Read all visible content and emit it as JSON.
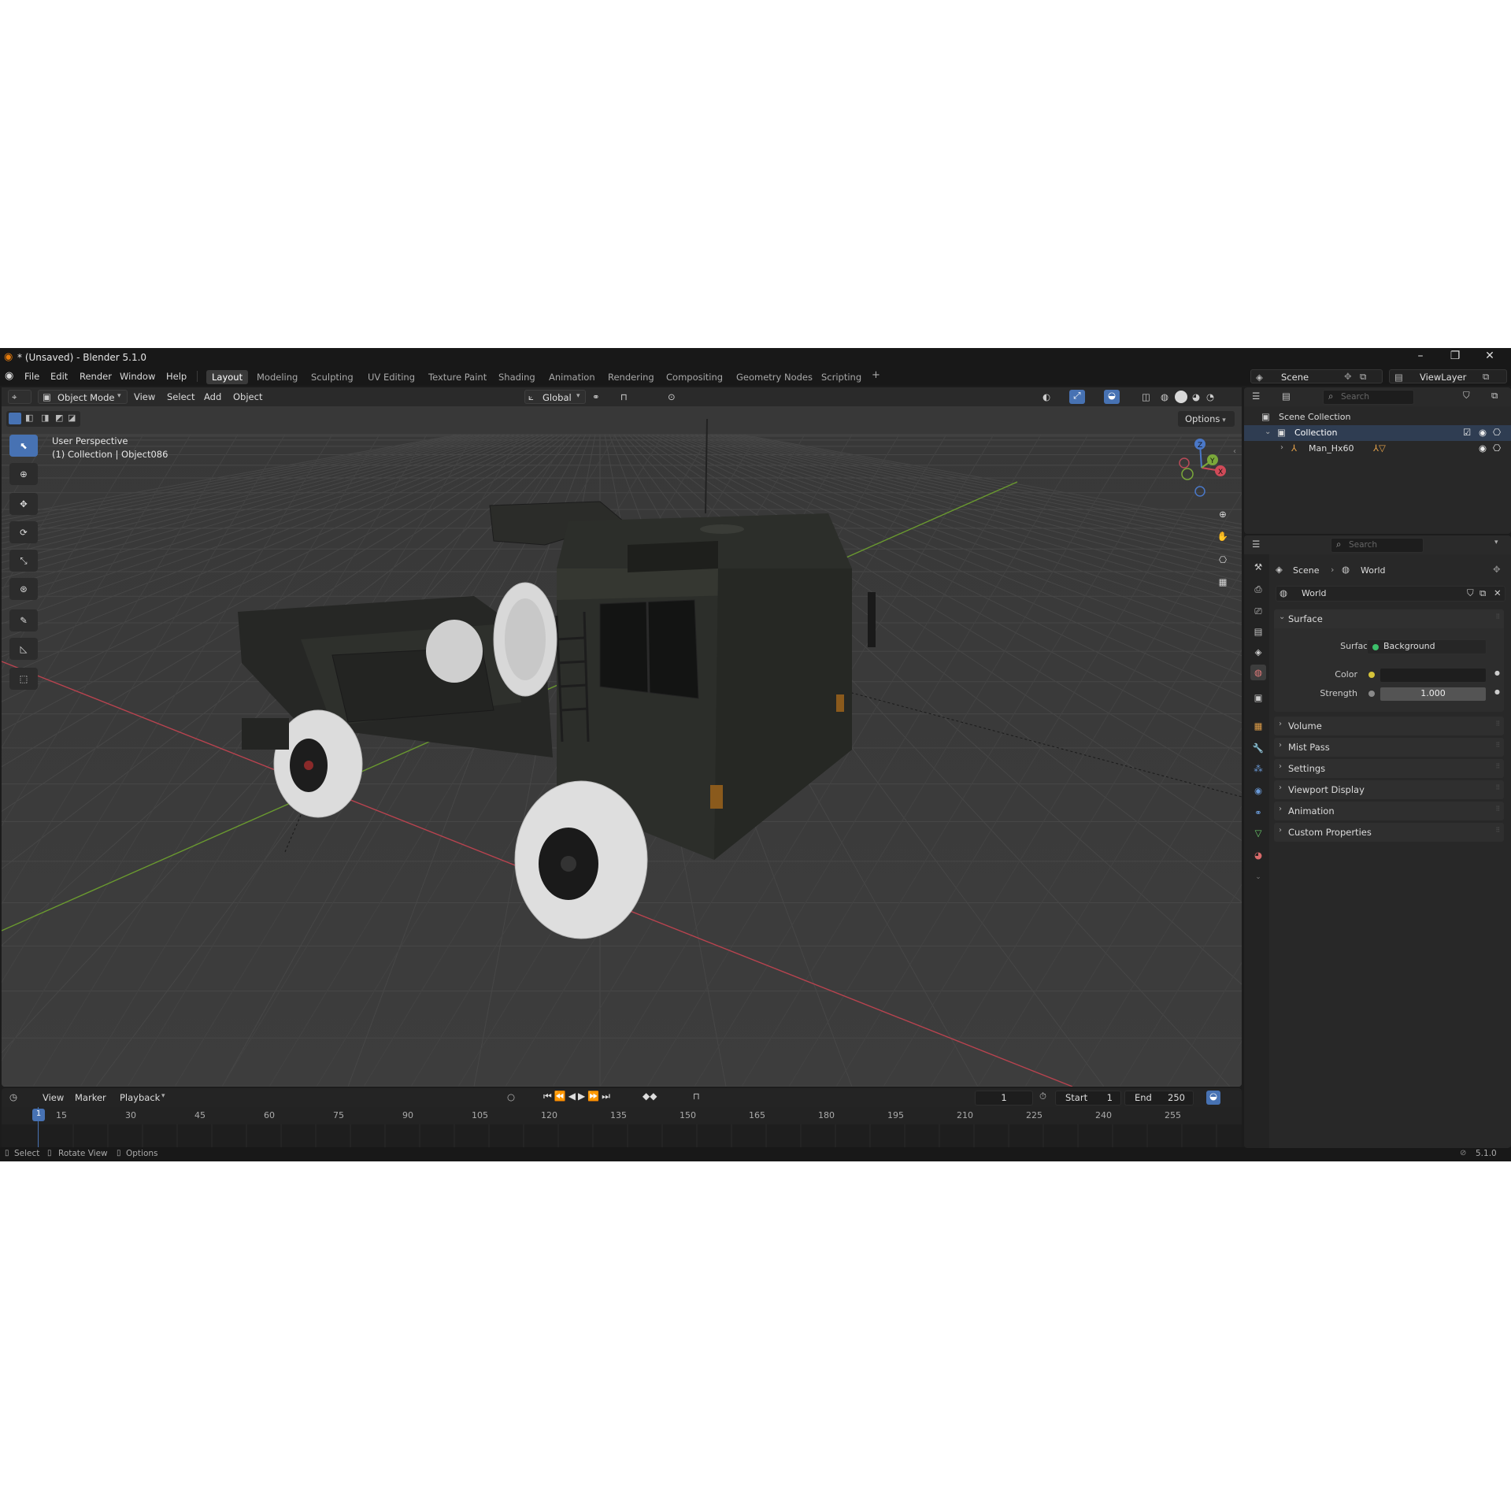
{
  "window": {
    "title": "* (Unsaved) - Blender 5.1.0",
    "minimize": "–",
    "maximize": "❐",
    "close": "✕"
  },
  "menu": {
    "items": [
      "File",
      "Edit",
      "Render",
      "Window",
      "Help"
    ],
    "workspaces": [
      "Layout",
      "Modeling",
      "Sculpting",
      "UV Editing",
      "Texture Paint",
      "Shading",
      "Animation",
      "Rendering",
      "Compositing",
      "Geometry Nodes",
      "Scripting"
    ],
    "active_workspace": "Layout",
    "add_workspace": "+",
    "scene": "Scene",
    "view_layer": "ViewLayer"
  },
  "viewport": {
    "mode": "Object Mode",
    "menus": [
      "View",
      "Select",
      "Add",
      "Object"
    ],
    "transform_orientation": "Global",
    "options": "Options",
    "perspective": "User Perspective",
    "context": "(1) Collection | Object086",
    "gizmo_axes": {
      "x": "X",
      "y": "Y",
      "z": "Z"
    },
    "colors": {
      "background": "#3b3b3b",
      "grid": "#4a4a4a",
      "x_axis": "#b8434f",
      "y_axis": "#6a9a2f",
      "truck": "#2a2c28",
      "tire": "#d8d8d8"
    }
  },
  "outliner": {
    "search_placeholder": "Search",
    "root": "Scene Collection",
    "collection": "Collection",
    "object": "Man_Hx60"
  },
  "properties": {
    "search_placeholder": "Search",
    "breadcrumb": [
      "Scene",
      "World"
    ],
    "world_name": "World",
    "surface_panel": "Surface",
    "surface_label": "Surface",
    "surface_value": "Background",
    "color_label": "Color",
    "strength_label": "Strength",
    "strength_value": "1.000",
    "panels": [
      "Volume",
      "Mist Pass",
      "Settings",
      "Viewport Display",
      "Animation",
      "Custom Properties"
    ]
  },
  "timeline": {
    "menus": [
      "View",
      "Marker",
      "Playback"
    ],
    "current_frame": "1",
    "start_label": "Start",
    "start": "1",
    "end_label": "End",
    "end": "250",
    "ruler": [
      "1",
      "15",
      "30",
      "45",
      "60",
      "75",
      "90",
      "105",
      "120",
      "135",
      "150",
      "165",
      "180",
      "195",
      "210",
      "225",
      "240",
      "255"
    ]
  },
  "statusbar": {
    "select": "Select",
    "rotate": "Rotate View",
    "options": "Options",
    "version": "5.1.0"
  }
}
